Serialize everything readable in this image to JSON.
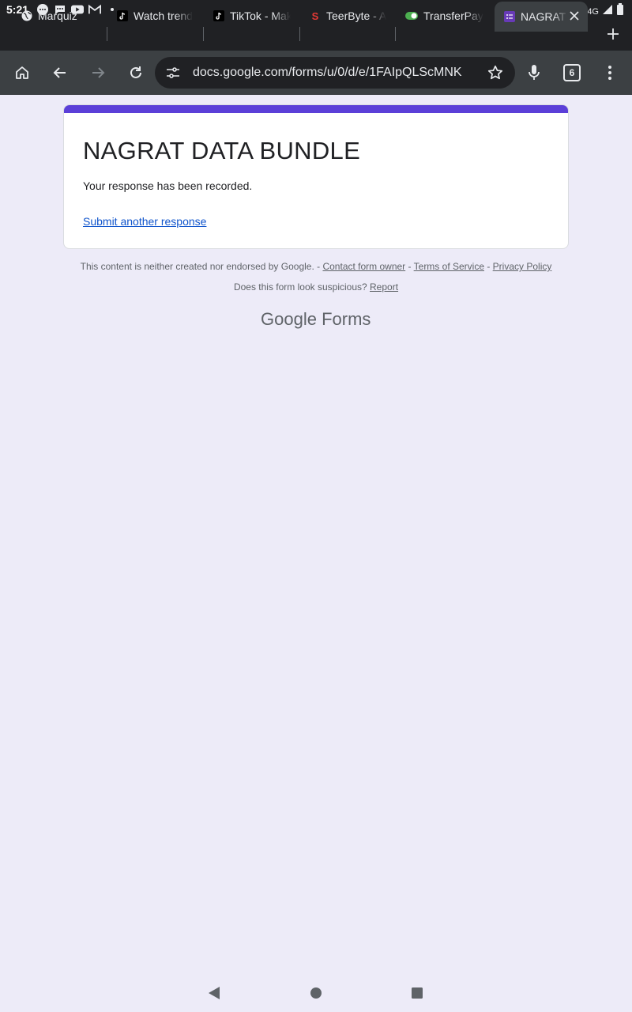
{
  "status_bar": {
    "time": "5:21",
    "notification_icons": [
      "chat-bubble-icon",
      "chat-bubble-icon",
      "youtube-icon",
      "gmail-icon",
      "dot-icon"
    ],
    "network_label": "4G"
  },
  "tabs": [
    {
      "title": "Marquiz",
      "favicon": "globe-icon"
    },
    {
      "title": "Watch trend",
      "favicon": "tiktok-icon"
    },
    {
      "title": "TikTok - Mak",
      "favicon": "tiktok-icon"
    },
    {
      "title": "TeerByte - A",
      "favicon": "teerbyte-icon"
    },
    {
      "title": "TransferPay",
      "favicon": "toggle-icon"
    },
    {
      "title": "NAGRAT",
      "favicon": "forms-icon",
      "active": true
    }
  ],
  "toolbar": {
    "url": "docs.google.com/forms/u/0/d/e/1FAIpQLScMNK",
    "tab_count": "6"
  },
  "form": {
    "title": "NAGRAT DATA BUNDLE",
    "message": "Your response has been recorded.",
    "another_link": "Submit another response",
    "accent_color": "#5b3fd8"
  },
  "footer": {
    "disclaimer": "This content is neither created nor endorsed by Google. - ",
    "contact": "Contact form owner",
    "terms": "Terms of Service",
    "privacy": "Privacy Policy",
    "separator": " - ",
    "suspicious": "Does this form look suspicious? ",
    "report": "Report",
    "logo_google": "Google",
    "logo_forms": "Forms"
  }
}
